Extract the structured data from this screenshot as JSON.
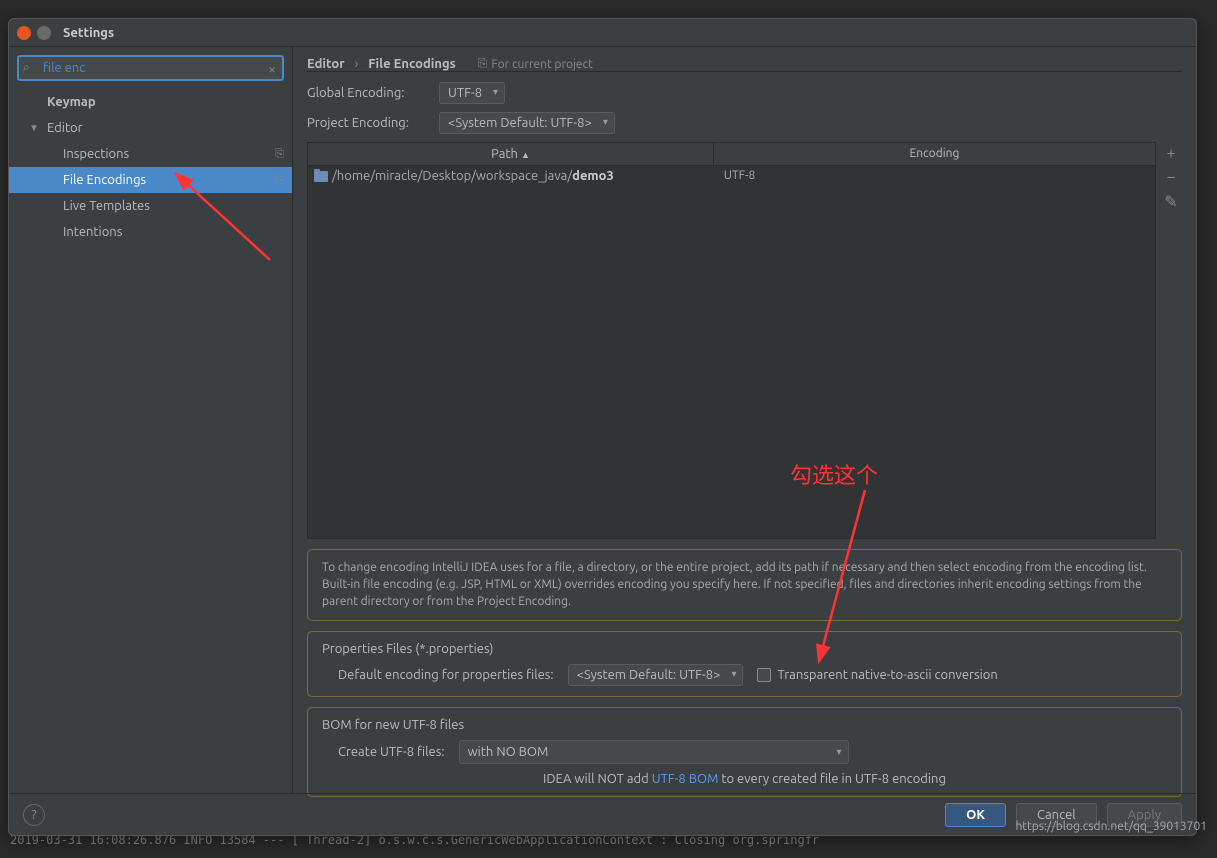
{
  "window": {
    "title": "Settings"
  },
  "search": {
    "value": "file enc"
  },
  "sidebar": {
    "items": [
      {
        "label": "Keymap",
        "level": 0
      },
      {
        "label": "Editor",
        "level": 1,
        "caret": true
      },
      {
        "label": "Inspections",
        "level": 2,
        "badge": "⎘"
      },
      {
        "label": "File Encodings",
        "level": 2,
        "selected": true,
        "badge": "⎘"
      },
      {
        "label": "Live Templates",
        "level": 2
      },
      {
        "label": "Intentions",
        "level": 2
      }
    ]
  },
  "breadcrumb": {
    "root": "Editor",
    "sep": "›",
    "current": "File Encodings",
    "scope": "For current project"
  },
  "globalEncoding": {
    "label": "Global Encoding:",
    "value": "UTF-8"
  },
  "projectEncoding": {
    "label": "Project Encoding:",
    "value": "<System Default: UTF-8>"
  },
  "table": {
    "cols": {
      "path": "Path",
      "encoding": "Encoding"
    },
    "row": {
      "pathPrefix": "/home/miracle/Desktop/workspace_java/",
      "pathName": "demo3",
      "encoding": "UTF-8"
    }
  },
  "hint": "To change encoding IntelliJ IDEA uses for a file, a directory, or the entire project, add its path if necessary and then select encoding from the encoding list. Built-in file encoding (e.g. JSP, HTML or XML) overrides encoding you specify here. If not specified, files and directories inherit encoding settings from the parent directory or from the Project Encoding.",
  "props": {
    "title": "Properties Files (*.properties)",
    "defaultLabel": "Default encoding for properties files:",
    "defaultValue": "<System Default: UTF-8>",
    "transparentLabel": "Transparent native-to-ascii conversion"
  },
  "bom": {
    "title": "BOM for new UTF-8 files",
    "createLabel": "Create UTF-8 files:",
    "createValue": "with NO BOM",
    "note1": "IDEA will NOT add ",
    "noteLink": "UTF-8 BOM",
    "note2": " to every created file in UTF-8 encoding"
  },
  "buttons": {
    "ok": "OK",
    "cancel": "Cancel",
    "apply": "Apply"
  },
  "annotation": {
    "text": "勾选这个"
  },
  "console": "2019-03-31 16:08:26.876  INFO 13584 --- [       Thread-2] o.s.w.c.s.GenericWebApplicationContext   : Closing org.springfr",
  "watermark": "https://blog.csdn.net/qq_39013701"
}
